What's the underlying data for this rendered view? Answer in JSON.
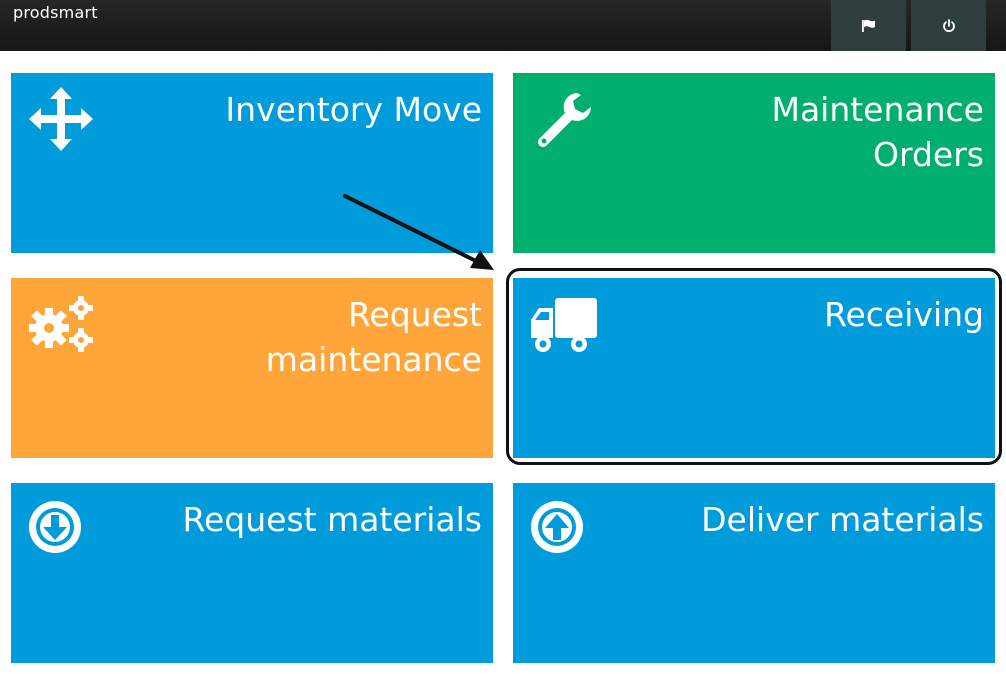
{
  "app": {
    "brand": "prodsmart"
  },
  "topbar": {
    "buttons": [
      {
        "icon": "flag-icon"
      },
      {
        "icon": "power-icon"
      }
    ]
  },
  "tiles": [
    {
      "label": "Inventory Move",
      "icon": "move-arrows-icon",
      "color": "#009bdb"
    },
    {
      "label": "Maintenance\nOrders",
      "icon": "wrench-icon",
      "color": "#00af6e"
    },
    {
      "label": "Request\nmaintenance",
      "icon": "gears-icon",
      "color": "#ffa53a"
    },
    {
      "label": "Receiving",
      "icon": "truck-icon",
      "color": "#009bdb",
      "highlighted": true
    },
    {
      "label": "Request materials",
      "icon": "circle-arrow-down-icon",
      "color": "#009bdb"
    },
    {
      "label": "Deliver materials",
      "icon": "circle-arrow-up-icon",
      "color": "#009bdb"
    }
  ],
  "colors": {
    "topbar": "#1b1b1b",
    "topbar_button": "#2f3d3c",
    "blue": "#009bdb",
    "green": "#00af6e",
    "orange": "#ffa53a",
    "annotation": "#111111"
  }
}
